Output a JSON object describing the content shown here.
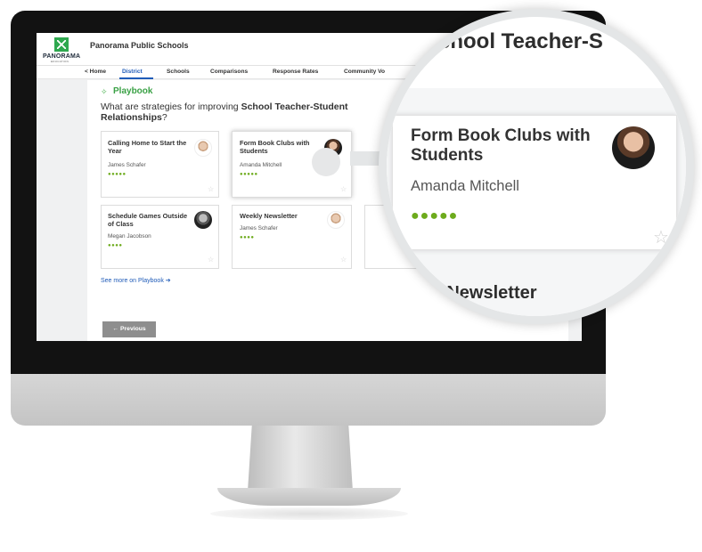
{
  "app": {
    "logo_text": "PANORAMA",
    "logo_sub": "EDUCATION",
    "org_name": "Panorama Public Schools"
  },
  "nav": {
    "items": [
      {
        "label": "< Home",
        "active": false
      },
      {
        "label": "District",
        "active": true
      },
      {
        "label": "Schools",
        "active": false
      },
      {
        "label": "Comparisons",
        "active": false
      },
      {
        "label": "Response Rates",
        "active": false
      },
      {
        "label": "Community Vo",
        "active": false
      }
    ]
  },
  "playbook": {
    "title": "Playbook",
    "question_prefix": "What are strategies for improving ",
    "question_bold": "School Teacher-Student Relationships",
    "question_suffix": "?",
    "cards": [
      {
        "title": "Calling Home to Start the Year",
        "author": "James Schafer",
        "rating": 5,
        "apples": "●●●●●"
      },
      {
        "title": "Form Book Clubs with Students",
        "author": "Amanda Mitchell",
        "rating": 5,
        "apples": "●●●●●",
        "selected": true
      },
      {
        "title": "Schedule Games Outside of Class",
        "author": "Megan Jacobson",
        "rating": 4,
        "apples": "●●●●"
      },
      {
        "title": "Weekly Newsletter",
        "author": "James Schafer",
        "rating": 4,
        "apples": "●●●●"
      }
    ],
    "see_more": "See more on Playbook ➔",
    "previous": "← Previous"
  },
  "magnifier": {
    "title_fragment": "chool Teacher-S",
    "card_title": "Form Book Clubs with Students",
    "card_author": "Amanda Mitchell",
    "apples": "●●●●●",
    "next_fragment": "kly Newsletter"
  },
  "icons": {
    "star": "☆",
    "playbook": "✧"
  },
  "colors": {
    "accent_green": "#3aa145",
    "link_blue": "#1f5bb8",
    "apple_green": "#6dab1c"
  }
}
